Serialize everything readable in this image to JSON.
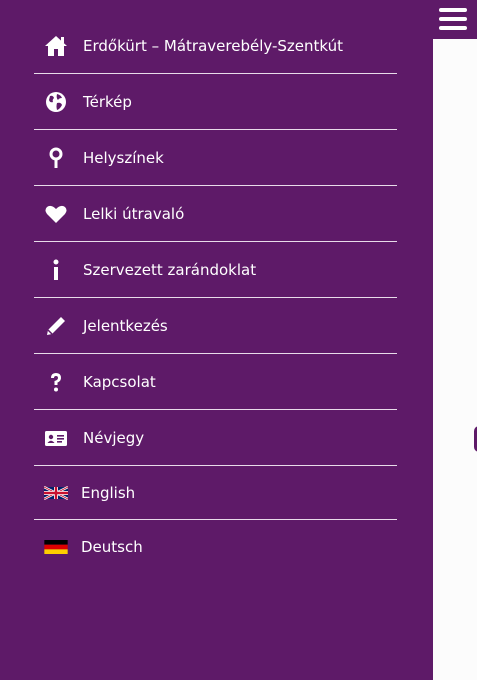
{
  "menu": {
    "items": [
      {
        "label": "Erdőkürt – Mátraverebély-Szentkút",
        "icon": "home-icon"
      },
      {
        "label": "Térkép",
        "icon": "globe-icon"
      },
      {
        "label": "Helyszínek",
        "icon": "location-pin-icon"
      },
      {
        "label": "Lelki útravaló",
        "icon": "heart-icon"
      },
      {
        "label": "Szervezett zarándoklat",
        "icon": "info-icon"
      },
      {
        "label": "Jelentkezés",
        "icon": "pencil-icon"
      },
      {
        "label": "Kapcsolat",
        "icon": "question-icon"
      },
      {
        "label": "Névjegy",
        "icon": "id-card-icon"
      }
    ],
    "languages": [
      {
        "label": "English",
        "icon": "uk-flag-icon"
      },
      {
        "label": "Deutsch",
        "icon": "german-flag-icon"
      }
    ]
  },
  "colors": {
    "drawer_bg": "#5e1a68",
    "text": "#ffffff",
    "divider": "#e8dcea"
  }
}
